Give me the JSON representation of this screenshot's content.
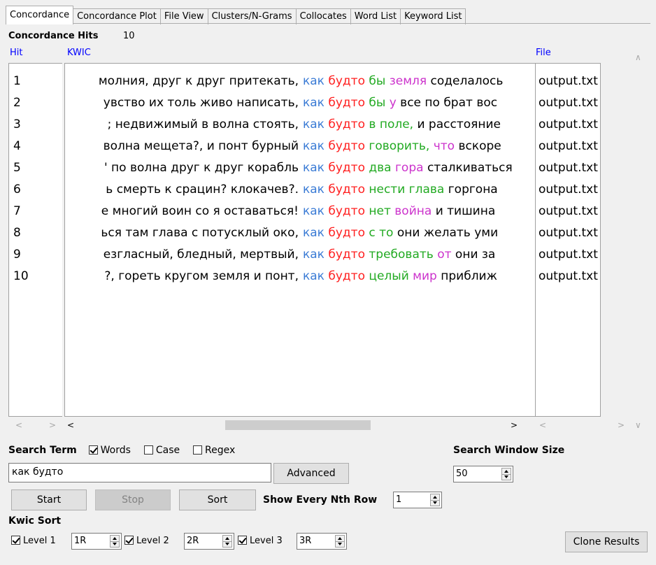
{
  "tabs": [
    {
      "label": "Concordance"
    },
    {
      "label": "Concordance Plot"
    },
    {
      "label": "File View"
    },
    {
      "label": "Clusters/N-Grams"
    },
    {
      "label": "Collocates"
    },
    {
      "label": "Word List"
    },
    {
      "label": "Keyword List"
    }
  ],
  "hits": {
    "label": "Concordance Hits",
    "count": "10"
  },
  "columns": {
    "hit": "Hit",
    "kwic": "KWIC",
    "file": "File"
  },
  "rows": [
    {
      "hit": "1",
      "left": "молния, друг к друг притекать,",
      "kw1": "как",
      "kw2": "будто",
      "r1": "бы",
      "r2": "земля",
      "rest": "соделалось",
      "r1c": "green",
      "r2c": "pink",
      "file": "output.txt"
    },
    {
      "hit": "2",
      "left": "увство их толь живо написать,",
      "kw1": "как",
      "kw2": "будто",
      "r1": "бы",
      "r2": "у",
      "rest": "все по брат вос",
      "r1c": "green",
      "r2c": "pink",
      "file": "output.txt"
    },
    {
      "hit": "3",
      "left": "; недвижимый в волна стоять,",
      "kw1": "как",
      "kw2": "будто",
      "r1": "в",
      "r2": "поле,",
      "rest": "и расстояние",
      "r1c": "green",
      "r2c": "green",
      "file": "output.txt"
    },
    {
      "hit": "4",
      "left": "волна мещета?, и понт бурный",
      "kw1": "как",
      "kw2": "будто",
      "r1": "говорить,",
      "r2": "что",
      "rest": "вскоре",
      "r1c": "green",
      "r2c": "pink",
      "file": "output.txt"
    },
    {
      "hit": "5",
      "left": "' по волна друг к друг корабль",
      "kw1": "как",
      "kw2": "будто",
      "r1": "два",
      "r2": "гора",
      "rest": "сталкиваться",
      "r1c": "green",
      "r2c": "pink",
      "file": "output.txt"
    },
    {
      "hit": "6",
      "left": "ь смерть к срацин? клокачев?.",
      "kw1": "как",
      "kw2": "будто",
      "r1": "нести",
      "r2": "глава",
      "rest": "горгона",
      "r1c": "green",
      "r2c": "green",
      "file": "output.txt"
    },
    {
      "hit": "7",
      "left": "е многий воин со я оставаться!",
      "kw1": "как",
      "kw2": "будто",
      "r1": "нет",
      "r2": "война",
      "rest": "и тишина",
      "r1c": "green",
      "r2c": "pink",
      "file": "output.txt"
    },
    {
      "hit": "8",
      "left": "ься там глава с потусклый око,",
      "kw1": "как",
      "kw2": "будто",
      "r1": "с то",
      "r2": "",
      "rest": "они желать уми",
      "r1c": "green",
      "r2c": "pink",
      "file": "output.txt"
    },
    {
      "hit": "9",
      "left": "езгласный, бледный, мертвый,",
      "kw1": "как",
      "kw2": "будто",
      "r1": "требовать",
      "r2": "от",
      "rest": "они за",
      "r1c": "green",
      "r2c": "pink",
      "file": "output.txt"
    },
    {
      "hit": "10",
      "left": "?, гореть кругом земля и понт,",
      "kw1": "как",
      "kw2": "будто",
      "r1": "целый",
      "r2": "мир",
      "rest": "приближ",
      "r1c": "green",
      "r2c": "pink",
      "file": "output.txt"
    }
  ],
  "search": {
    "label": "Search Term",
    "words_label": "Words",
    "words_checked": true,
    "case_label": "Case",
    "case_checked": false,
    "regex_label": "Regex",
    "regex_checked": false,
    "value": "как будто",
    "advanced_label": "Advanced"
  },
  "window_size": {
    "label": "Search Window Size",
    "value": "50"
  },
  "buttons": {
    "start": "Start",
    "stop": "Stop",
    "sort": "Sort",
    "clone": "Clone Results"
  },
  "nth_row": {
    "label": "Show Every Nth Row",
    "value": "1"
  },
  "kwic_sort": {
    "label": "Kwic Sort",
    "levels": [
      {
        "label": "Level 1",
        "value": "1R",
        "checked": true
      },
      {
        "label": "Level 2",
        "value": "2R",
        "checked": true
      },
      {
        "label": "Level 3",
        "value": "3R",
        "checked": true
      }
    ]
  },
  "colors": {
    "blue": "#3a7bd5",
    "red": "#ff2020",
    "green": "#22aa22",
    "pink": "#cc33cc"
  }
}
